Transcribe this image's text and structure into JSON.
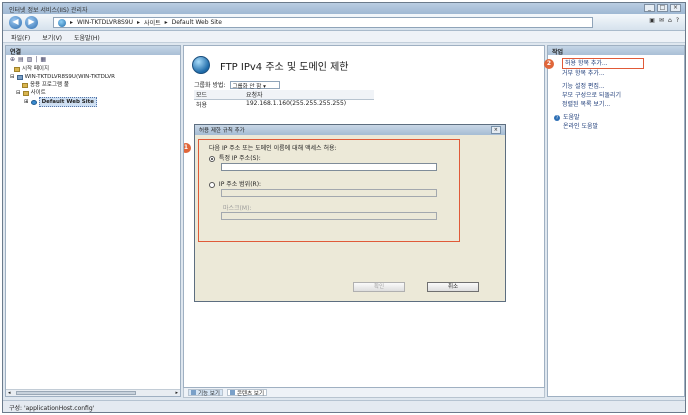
{
  "window": {
    "title": "인터넷 정보 서비스(IIS) 관리자",
    "buttons": [
      "_",
      "□",
      "×"
    ]
  },
  "address": {
    "segments": [
      "WIN-TKTDLVR8S9U",
      "사이트",
      "Default Web Site"
    ],
    "separator": "▸",
    "tools": [
      "▣",
      "✉",
      "⌂",
      "?"
    ]
  },
  "menu": {
    "items": [
      "파일(F)",
      "보기(V)",
      "도움말(H)"
    ]
  },
  "connections": {
    "header": "연결",
    "toolbar": [
      "⊕",
      "▤",
      "▨",
      "|",
      "▦"
    ],
    "tree": {
      "start_page": "시작 페이지",
      "server": "WIN-TKTDLVR8S9U(WIN-TKTDLVR",
      "app_pools": "응용 프로그램 풀",
      "sites": "사이트",
      "default_site": "Default Web Site"
    }
  },
  "feature": {
    "title": "FTP IPv4 주소 및 도메인 제한",
    "group_label": "그룹화 방법:",
    "group_value": "그룹화 안 함",
    "columns": [
      "모드",
      "요청자"
    ],
    "rows": [
      [
        "허용",
        "192.168.1.160(255.255.255.255)"
      ]
    ]
  },
  "view_tabs": {
    "features": "기능 보기",
    "content": "콘텐츠 보기"
  },
  "actions": {
    "header": "작업",
    "add_allow": "허용 항목 추가...",
    "add_deny": "거부 항목 추가...",
    "edit_settings": "기능 설정 편집...",
    "revert": "부모 구성으로 되돌리기",
    "view_order": "정렬된 목록 보기...",
    "help": "도움말",
    "online_help": "온라인 도움말"
  },
  "dialog": {
    "title": "허용 제한 규칙 추가",
    "close": "×",
    "allow_label": "다음 IP 주소 또는 도메인 이름에 대해 액세스 허용:",
    "specific_ip": "특정 IP 주소(S):",
    "ip_range": "IP 주소 범위(R):",
    "mask_label": "마스크(M):",
    "ok": "확인",
    "cancel": "취소"
  },
  "badges": {
    "step1": "1",
    "step2": "2"
  },
  "status": {
    "text": "구성: 'applicationHost.config'"
  }
}
